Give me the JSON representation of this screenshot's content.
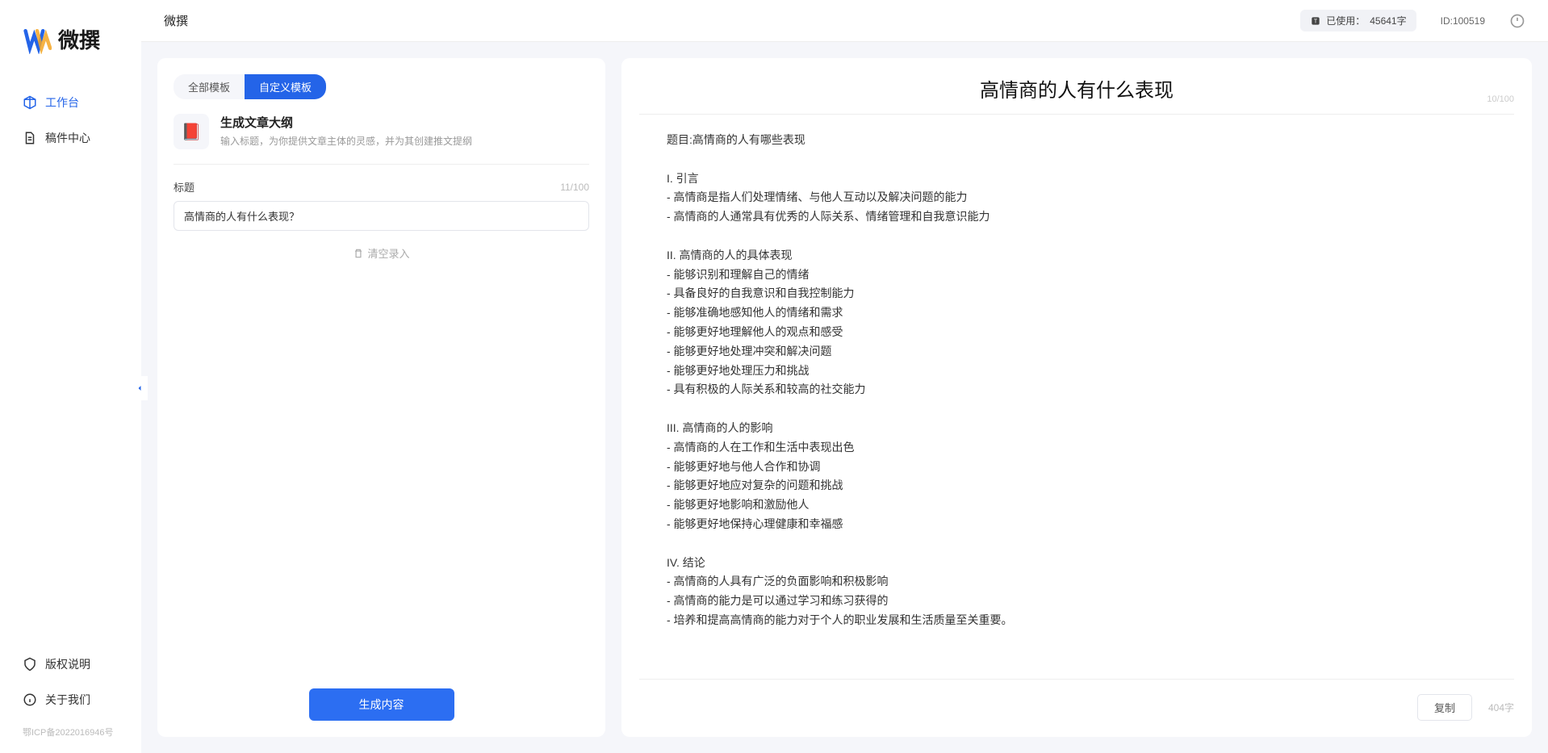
{
  "app": {
    "name": "微撰",
    "title_header": "微撰"
  },
  "nav": {
    "workspace": "工作台",
    "drafts": "稿件中心",
    "copyright": "版权说明",
    "about": "关于我们",
    "icp": "鄂ICP备2022016946号"
  },
  "header": {
    "usage_label": "已使用：",
    "usage_value": "45641字",
    "user_id": "ID:100519"
  },
  "tabs": {
    "all": "全部模板",
    "custom": "自定义模板"
  },
  "template": {
    "icon": "📕",
    "title": "生成文章大纲",
    "desc": "输入标题，为你提供文章主体的灵感，并为其创建推文提纲"
  },
  "form": {
    "title_label": "标题",
    "title_counter": "11/100",
    "title_value": "高情商的人有什么表现？",
    "clear": "清空录入",
    "generate": "生成内容"
  },
  "output": {
    "title": "高情商的人有什么表现",
    "head_counter": "10/100",
    "body": "题目:高情商的人有哪些表现\n\nI. 引言\n- 高情商是指人们处理情绪、与他人互动以及解决问题的能力\n- 高情商的人通常具有优秀的人际关系、情绪管理和自我意识能力\n\nII. 高情商的人的具体表现\n- 能够识别和理解自己的情绪\n- 具备良好的自我意识和自我控制能力\n- 能够准确地感知他人的情绪和需求\n- 能够更好地理解他人的观点和感受\n- 能够更好地处理冲突和解决问题\n- 能够更好地处理压力和挑战\n- 具有积极的人际关系和较高的社交能力\n\nIII. 高情商的人的影响\n- 高情商的人在工作和生活中表现出色\n- 能够更好地与他人合作和协调\n- 能够更好地应对复杂的问题和挑战\n- 能够更好地影响和激励他人\n- 能够更好地保持心理健康和幸福感\n\nIV. 结论\n- 高情商的人具有广泛的负面影响和积极影响\n- 高情商的能力是可以通过学习和练习获得的\n- 培养和提高高情商的能力对于个人的职业发展和生活质量至关重要。",
    "copy": "复制",
    "char_count": "404字"
  }
}
